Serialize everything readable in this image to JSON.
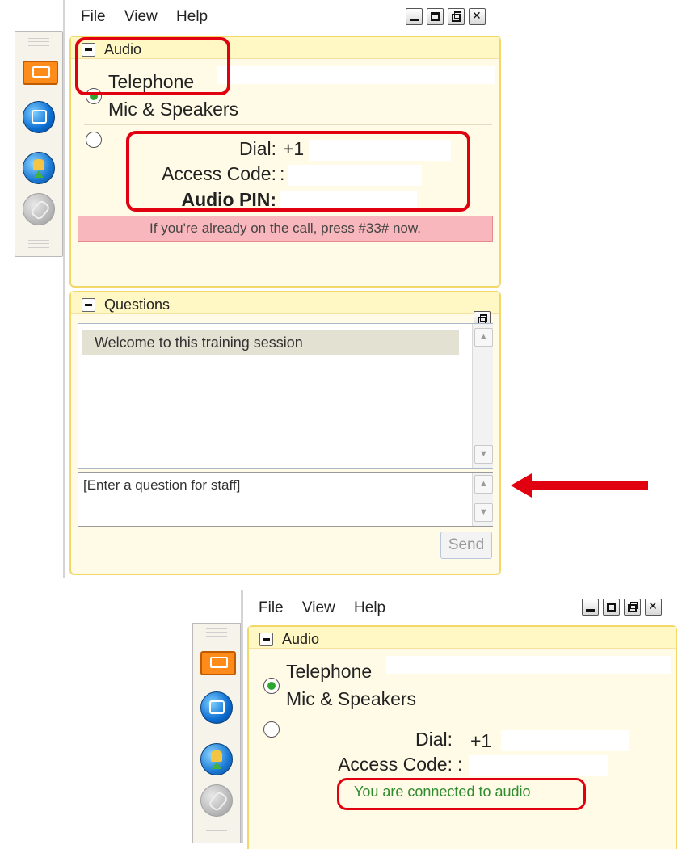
{
  "top_window": {
    "menu": [
      "File",
      "View",
      "Help"
    ],
    "audio_pod": {
      "title": "Audio",
      "options": [
        {
          "label": "Telephone",
          "selected": true
        },
        {
          "label": "Mic & Speakers",
          "selected": false
        }
      ],
      "dial_label": "Dial:",
      "dial_value": "+1",
      "access_code_label": "Access Code:",
      "access_code_value": ":",
      "audio_pin_label": "Audio PIN:",
      "notice": "If you're already on the call, press #33# now."
    },
    "questions_pod": {
      "title": "Questions",
      "welcome_message": "Welcome to this training session",
      "input_placeholder": "[Enter a question for staff]",
      "send_label": "Send"
    }
  },
  "bottom_window": {
    "menu": [
      "File",
      "View",
      "Help"
    ],
    "audio_pod": {
      "title": "Audio",
      "options": [
        {
          "label": "Telephone",
          "selected": true
        },
        {
          "label": "Mic & Speakers",
          "selected": false
        }
      ],
      "dial_label": "Dial:",
      "dial_value": "+1",
      "access_code_label": "Access Code:",
      "access_code_value": ":",
      "status": "You are connected to audio"
    }
  },
  "colors": {
    "pod_border": "#f2d76a",
    "pod_bg": "#fffbe6",
    "highlight_red": "#e00010",
    "notice_pink": "#f8b7bc",
    "connected_green": "#2e8b2e"
  },
  "icons": [
    "arrow-icon",
    "window-icon",
    "raise-hand-icon",
    "disabled-icon",
    "minimize-icon",
    "maximize-icon",
    "restore-icon",
    "close-icon"
  ]
}
